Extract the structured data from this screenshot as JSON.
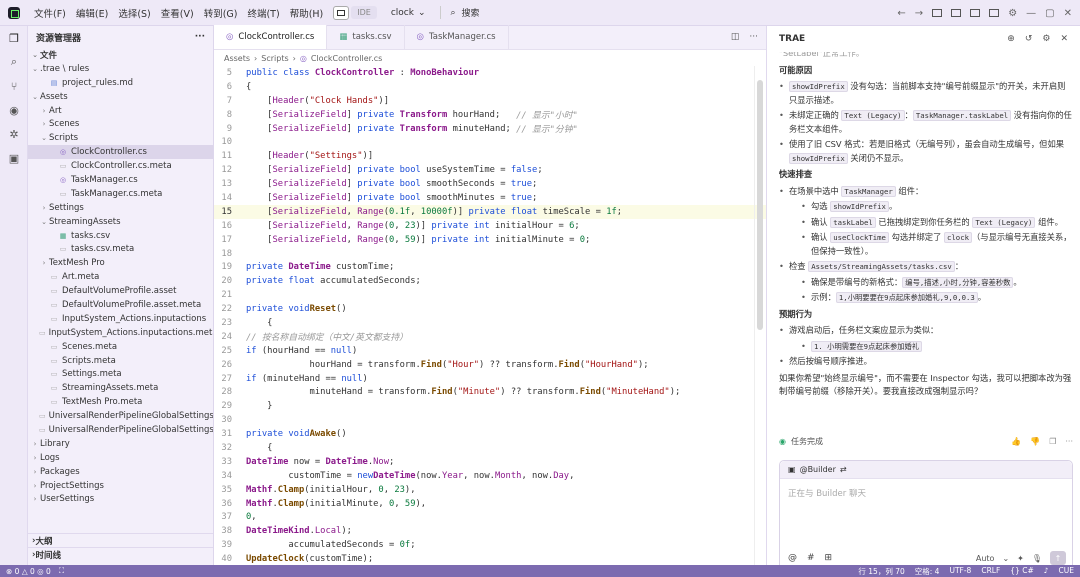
{
  "titlebar": {
    "menus": [
      "文件(F)",
      "编辑(E)",
      "选择(S)",
      "查看(V)",
      "转到(G)",
      "终端(T)",
      "帮助(H)"
    ],
    "mode_label": "IDE",
    "project": "clock",
    "search_label": "搜索"
  },
  "explorer": {
    "title": "资源管理器",
    "section": "文件",
    "items": [
      {
        "label": ".trae \\ rules",
        "depth": 1,
        "kind": "folder",
        "open": true
      },
      {
        "label": "project_rules.md",
        "depth": 2,
        "kind": "md"
      },
      {
        "label": "Assets",
        "depth": 1,
        "kind": "folder",
        "open": true
      },
      {
        "label": "Art",
        "depth": 2,
        "kind": "folder"
      },
      {
        "label": "Scenes",
        "depth": 2,
        "kind": "folder"
      },
      {
        "label": "Scripts",
        "depth": 2,
        "kind": "folder",
        "open": true
      },
      {
        "label": "ClockController.cs",
        "depth": 3,
        "kind": "cs",
        "selected": true
      },
      {
        "label": "ClockController.cs.meta",
        "depth": 3,
        "kind": "txt"
      },
      {
        "label": "TaskManager.cs",
        "depth": 3,
        "kind": "cs"
      },
      {
        "label": "TaskManager.cs.meta",
        "depth": 3,
        "kind": "txt"
      },
      {
        "label": "Settings",
        "depth": 2,
        "kind": "folder"
      },
      {
        "label": "StreamingAssets",
        "depth": 2,
        "kind": "folder",
        "open": true
      },
      {
        "label": "tasks.csv",
        "depth": 3,
        "kind": "csv"
      },
      {
        "label": "tasks.csv.meta",
        "depth": 3,
        "kind": "txt"
      },
      {
        "label": "TextMesh Pro",
        "depth": 2,
        "kind": "folder"
      },
      {
        "label": "Art.meta",
        "depth": 2,
        "kind": "txt"
      },
      {
        "label": "DefaultVolumeProfile.asset",
        "depth": 2,
        "kind": "txt"
      },
      {
        "label": "DefaultVolumeProfile.asset.meta",
        "depth": 2,
        "kind": "txt"
      },
      {
        "label": "InputSystem_Actions.inputactions",
        "depth": 2,
        "kind": "txt"
      },
      {
        "label": "InputSystem_Actions.inputactions.meta",
        "depth": 2,
        "kind": "txt"
      },
      {
        "label": "Scenes.meta",
        "depth": 2,
        "kind": "txt"
      },
      {
        "label": "Scripts.meta",
        "depth": 2,
        "kind": "txt"
      },
      {
        "label": "Settings.meta",
        "depth": 2,
        "kind": "txt"
      },
      {
        "label": "StreamingAssets.meta",
        "depth": 2,
        "kind": "txt"
      },
      {
        "label": "TextMesh Pro.meta",
        "depth": 2,
        "kind": "txt"
      },
      {
        "label": "UniversalRenderPipelineGlobalSettings...",
        "depth": 2,
        "kind": "txt"
      },
      {
        "label": "UniversalRenderPipelineGlobalSettings...",
        "depth": 2,
        "kind": "txt"
      },
      {
        "label": "Library",
        "depth": 1,
        "kind": "folder"
      },
      {
        "label": "Logs",
        "depth": 1,
        "kind": "folder"
      },
      {
        "label": "Packages",
        "depth": 1,
        "kind": "folder"
      },
      {
        "label": "ProjectSettings",
        "depth": 1,
        "kind": "folder"
      },
      {
        "label": "UserSettings",
        "depth": 1,
        "kind": "folder"
      }
    ],
    "footer": [
      "大纲",
      "时间线"
    ]
  },
  "editor": {
    "tabs": [
      {
        "label": "ClockController.cs",
        "active": true,
        "kind": "cs"
      },
      {
        "label": "tasks.csv",
        "active": false,
        "kind": "csv"
      },
      {
        "label": "TaskManager.cs",
        "active": false,
        "kind": "cs"
      }
    ],
    "breadcrumb": [
      "Assets",
      "Scripts",
      "ClockController.cs"
    ],
    "current_line": "15"
  },
  "chat": {
    "title": "TRAE",
    "task_done": "任务完成",
    "input_tag": "@Builder",
    "input_placeholder": "正在与 Builder 聊天",
    "model": "Auto",
    "overflow_text": "\"SetLabel\"正常工作。"
  },
  "status": {
    "left": "⊗ 0 △ 0  ◎ 0",
    "position": "行 15，列 70",
    "indent": "空格: 4",
    "encoding": "UTF-8",
    "eol": "CRLF",
    "lang": "{} C#",
    "ime": "CUE"
  }
}
